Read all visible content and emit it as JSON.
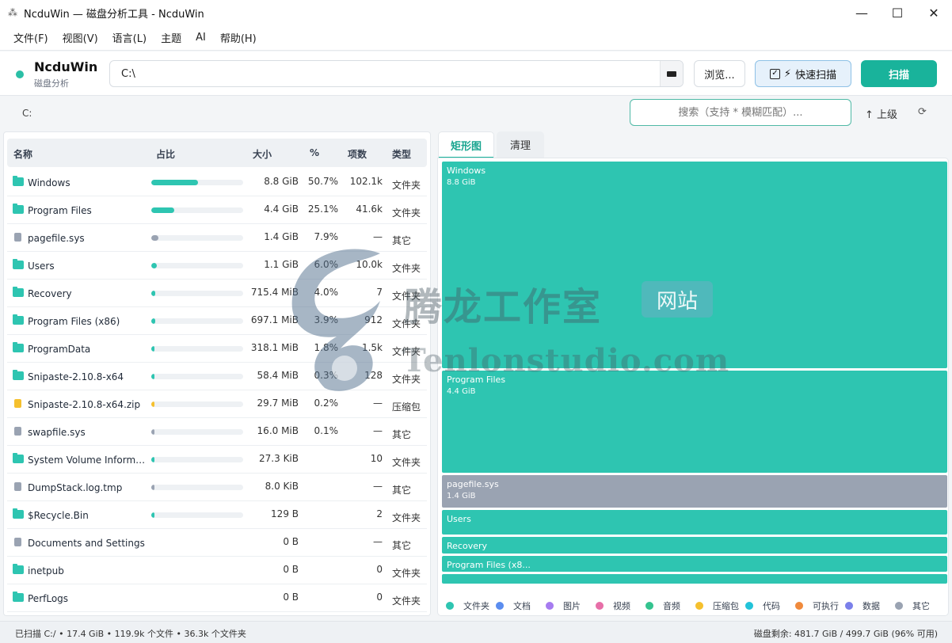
{
  "window": {
    "title": "NcduWin — 磁盘分析工具 - NcduWin"
  },
  "menu": [
    "文件(F)",
    "视图(V)",
    "语言(L)",
    "主题",
    "AI",
    "帮助(H)"
  ],
  "toolbar": {
    "brand_title": "NcduWin",
    "brand_subtitle": "磁盘分析",
    "path_value": "C:\\",
    "browse_label": "浏览...",
    "quick_scan_label": "快速扫描",
    "quick_scan_checked": true,
    "scan_label": "扫描"
  },
  "nav": {
    "breadcrumb": "C:",
    "search_placeholder": "搜索（支持 * 模糊匹配）...",
    "up_label": "↑ 上级"
  },
  "table": {
    "headers": {
      "name": "名称",
      "ratio": "占比",
      "size": "大小",
      "percent": "%",
      "items": "项数",
      "type": "类型"
    },
    "rows": [
      {
        "name": "Windows",
        "kind": "folder",
        "ratio": 0.507,
        "size": "8.8 GiB",
        "percent": "50.7%",
        "items": "102.1k",
        "type": "文件夹"
      },
      {
        "name": "Program Files",
        "kind": "folder",
        "ratio": 0.251,
        "size": "4.4 GiB",
        "percent": "25.1%",
        "items": "41.6k",
        "type": "文件夹"
      },
      {
        "name": "pagefile.sys",
        "kind": "other",
        "ratio": 0.079,
        "size": "1.4 GiB",
        "percent": "7.9%",
        "items": "—",
        "type": "其它"
      },
      {
        "name": "Users",
        "kind": "folder",
        "ratio": 0.06,
        "size": "1.1 GiB",
        "percent": "6.0%",
        "items": "10.0k",
        "type": "文件夹"
      },
      {
        "name": "Recovery",
        "kind": "folder",
        "ratio": 0.04,
        "size": "715.4 MiB",
        "percent": "4.0%",
        "items": "7",
        "type": "文件夹"
      },
      {
        "name": "Program Files (x86)",
        "kind": "folder",
        "ratio": 0.039,
        "size": "697.1 MiB",
        "percent": "3.9%",
        "items": "912",
        "type": "文件夹"
      },
      {
        "name": "ProgramData",
        "kind": "folder",
        "ratio": 0.018,
        "size": "318.1 MiB",
        "percent": "1.8%",
        "items": "1.5k",
        "type": "文件夹"
      },
      {
        "name": "Snipaste-2.10.8-x64",
        "kind": "folder",
        "ratio": 0.003,
        "size": "58.4 MiB",
        "percent": "0.3%",
        "items": "128",
        "type": "文件夹"
      },
      {
        "name": "Snipaste-2.10.8-x64.zip",
        "kind": "archive",
        "ratio": 0.002,
        "size": "29.7 MiB",
        "percent": "0.2%",
        "items": "—",
        "type": "压缩包"
      },
      {
        "name": "swapfile.sys",
        "kind": "other",
        "ratio": 0.001,
        "size": "16.0 MiB",
        "percent": "0.1%",
        "items": "—",
        "type": "其它"
      },
      {
        "name": "System Volume Inform…",
        "kind": "folder",
        "ratio": 0.0005,
        "size": "27.3 KiB",
        "percent": "",
        "items": "10",
        "type": "文件夹"
      },
      {
        "name": "DumpStack.log.tmp",
        "kind": "other",
        "ratio": 0.0003,
        "size": "8.0 KiB",
        "percent": "",
        "items": "—",
        "type": "其它"
      },
      {
        "name": "$Recycle.Bin",
        "kind": "folder",
        "ratio": 0.0002,
        "size": "129 B",
        "percent": "",
        "items": "2",
        "type": "文件夹"
      },
      {
        "name": "Documents and Settings",
        "kind": "other",
        "ratio": 0,
        "size": "0 B",
        "percent": "",
        "items": "—",
        "type": "其它"
      },
      {
        "name": "inetpub",
        "kind": "folder",
        "ratio": 0,
        "size": "0 B",
        "percent": "",
        "items": "0",
        "type": "文件夹"
      },
      {
        "name": "PerfLogs",
        "kind": "folder",
        "ratio": 0,
        "size": "0 B",
        "percent": "",
        "items": "0",
        "type": "文件夹"
      }
    ]
  },
  "kind_colors": {
    "folder": "#2ec5b1",
    "other": "#9aa3b2",
    "archive": "#f5c02e"
  },
  "tabs": {
    "treemap": "矩形图",
    "clean": "清理"
  },
  "treemap": {
    "blocks": [
      {
        "name": "Windows",
        "size": "8.8 GiB",
        "share": 0.507,
        "kind": "folder"
      },
      {
        "name": "Program Files",
        "size": "4.4 GiB",
        "share": 0.251,
        "kind": "folder"
      },
      {
        "name": "pagefile.sys",
        "size": "1.4 GiB",
        "share": 0.079,
        "kind": "other"
      },
      {
        "name": "Users",
        "size": "",
        "share": 0.06,
        "kind": "folder"
      },
      {
        "name": "Recovery",
        "size": "",
        "share": 0.04,
        "kind": "folder"
      },
      {
        "name": "Program Files (x8...",
        "size": "",
        "share": 0.039,
        "kind": "folder"
      },
      {
        "name": "",
        "size": "",
        "share": 0.024,
        "kind": "folder"
      }
    ],
    "legend": [
      {
        "label": "文件夹",
        "color": "#2ec5b1"
      },
      {
        "label": "文档",
        "color": "#5b8def"
      },
      {
        "label": "图片",
        "color": "#a67cf0"
      },
      {
        "label": "视频",
        "color": "#e76fa8"
      },
      {
        "label": "音频",
        "color": "#34c38f"
      },
      {
        "label": "压缩包",
        "color": "#f5c02e"
      },
      {
        "label": "代码",
        "color": "#22c3d9"
      },
      {
        "label": "可执行",
        "color": "#f08a3c"
      },
      {
        "label": "数据",
        "color": "#7b80ea"
      },
      {
        "label": "其它",
        "color": "#9aa3b2"
      }
    ]
  },
  "watermark": {
    "cn": "腾龙工作室",
    "badge": "网站",
    "en": "Tenlonstudio.com"
  },
  "status": {
    "left": "已扫描 C:/  •  17.4 GiB  •  119.9k 个文件  •  36.3k 个文件夹",
    "right": "磁盘剩余: 481.7 GiB / 499.7 GiB (96% 可用)"
  }
}
